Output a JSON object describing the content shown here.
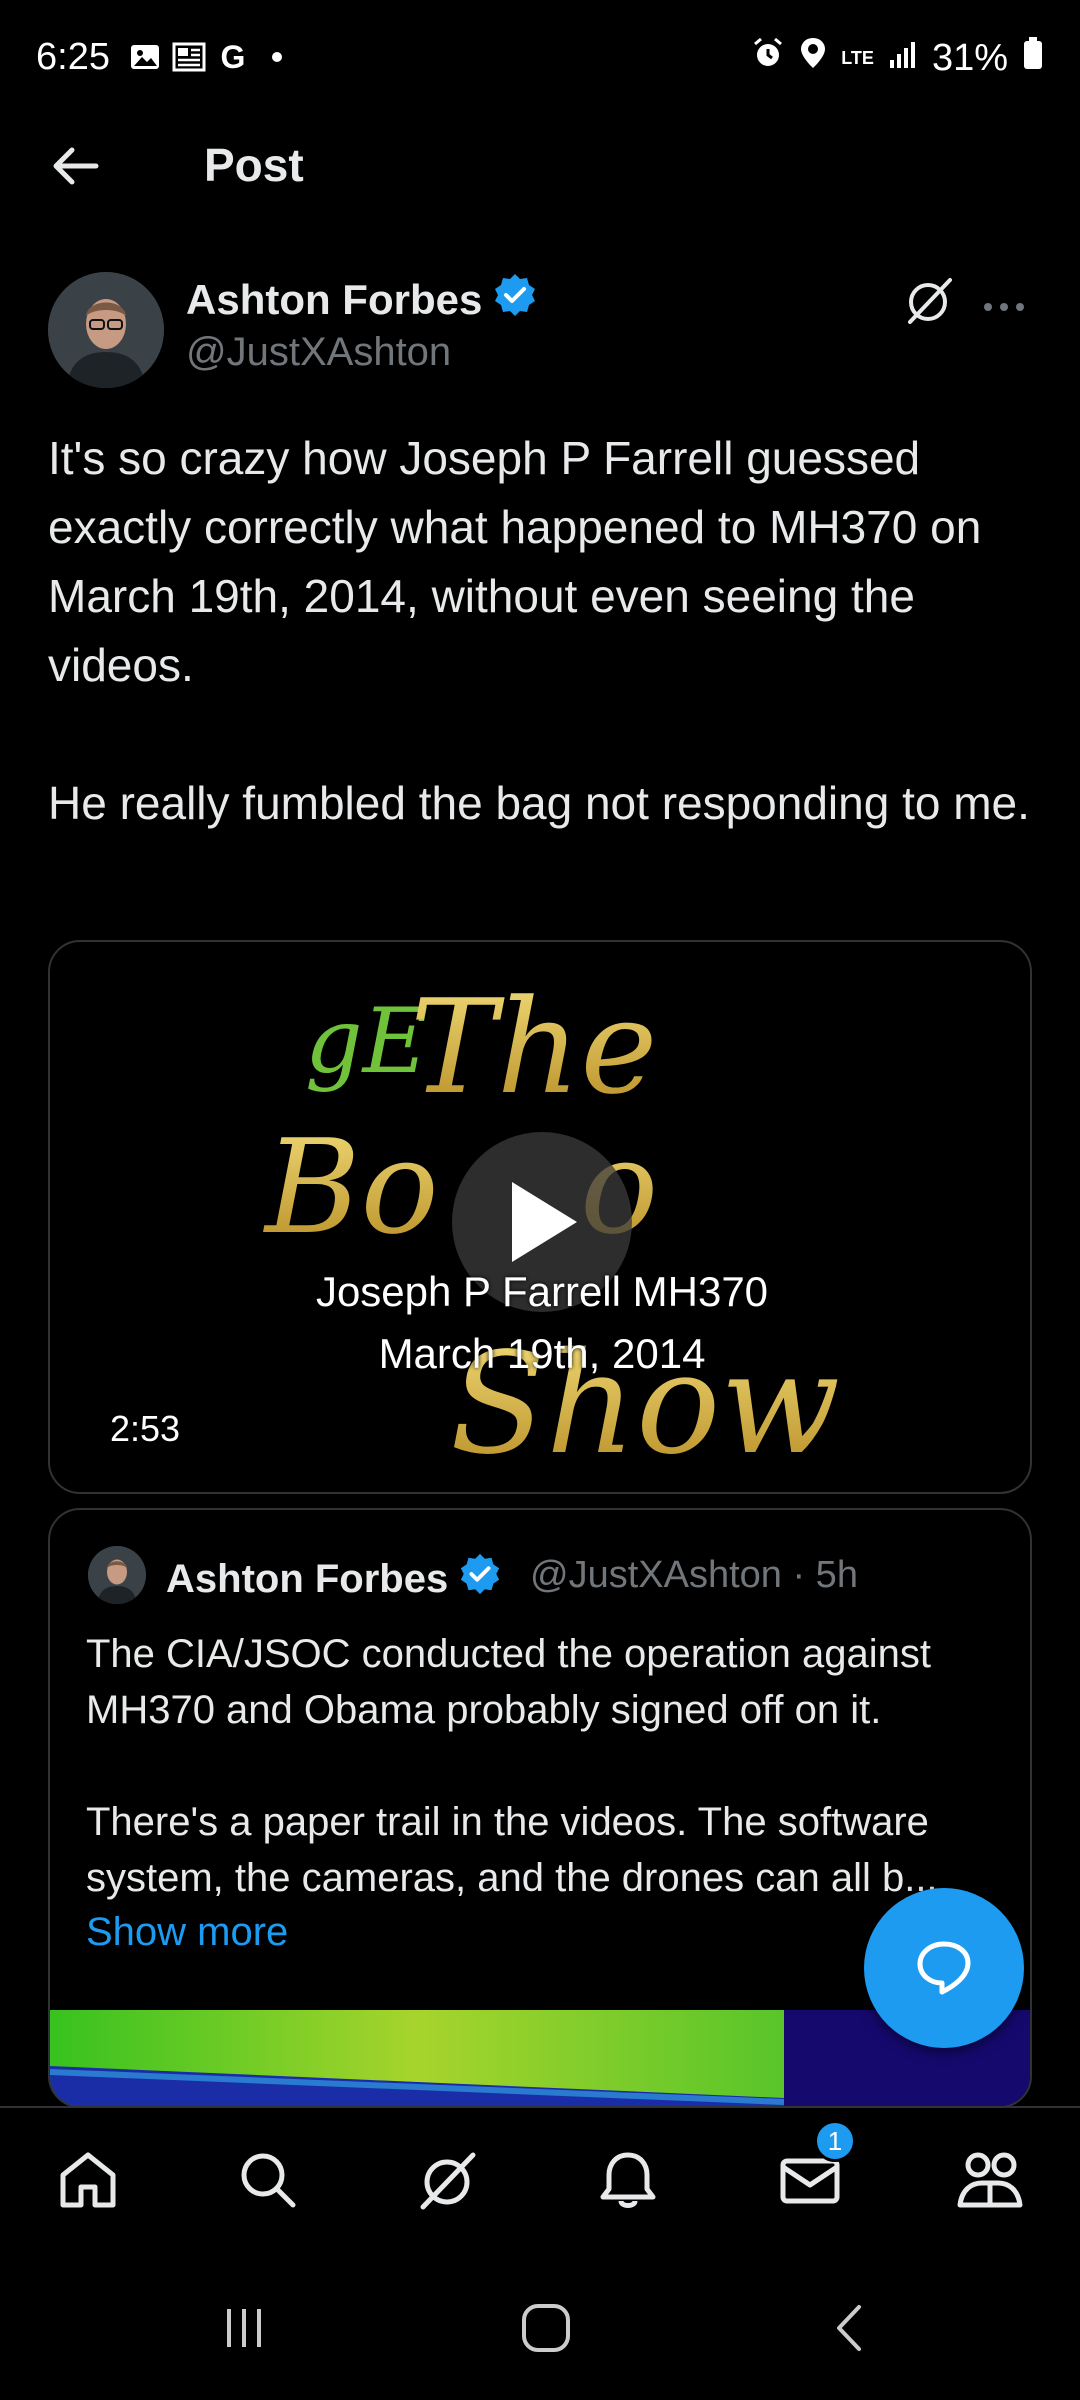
{
  "status_bar": {
    "time": "6:25",
    "left_icons": [
      "image-icon",
      "news-icon",
      "google-icon",
      "dot-icon"
    ],
    "google_glyph": "G",
    "network": "LTE",
    "battery": "31%"
  },
  "header": {
    "title": "Post"
  },
  "post": {
    "author_name": "Ashton Forbes",
    "author_handle": "@JustXAshton",
    "text": "It's so crazy how Joseph P Farrell guessed exactly correctly what happened to MH370 on March 19th, 2014, without even seeing the videos.\n\nHe really fumbled the bag not responding to me.",
    "video": {
      "caption_line1": "Joseph P Farrell MH370",
      "caption_line2": "March 19th, 2014",
      "duration": "2:53",
      "poster_text": {
        "initials": "gE",
        "line1": "The",
        "line2": "Bo",
        "line2b": "o",
        "line3": "Show"
      }
    },
    "quoted": {
      "author_name": "Ashton Forbes",
      "meta": "@JustXAshton · 5h",
      "text": "The CIA/JSOC conducted the operation against MH370 and Obama probably signed off on it.\n\nThere's a paper trail in the videos. The software system, the cameras, and the drones can all b...",
      "show_more": "Show more"
    }
  },
  "bottom_nav": {
    "items": [
      "home-icon",
      "search-icon",
      "grok-icon",
      "notifications-icon",
      "messages-icon",
      "communities-icon"
    ],
    "messages_badge": "1"
  },
  "colors": {
    "accent": "#1d9bf0",
    "background": "#000000",
    "text": "#e7e9ea",
    "secondary": "#71767b"
  }
}
